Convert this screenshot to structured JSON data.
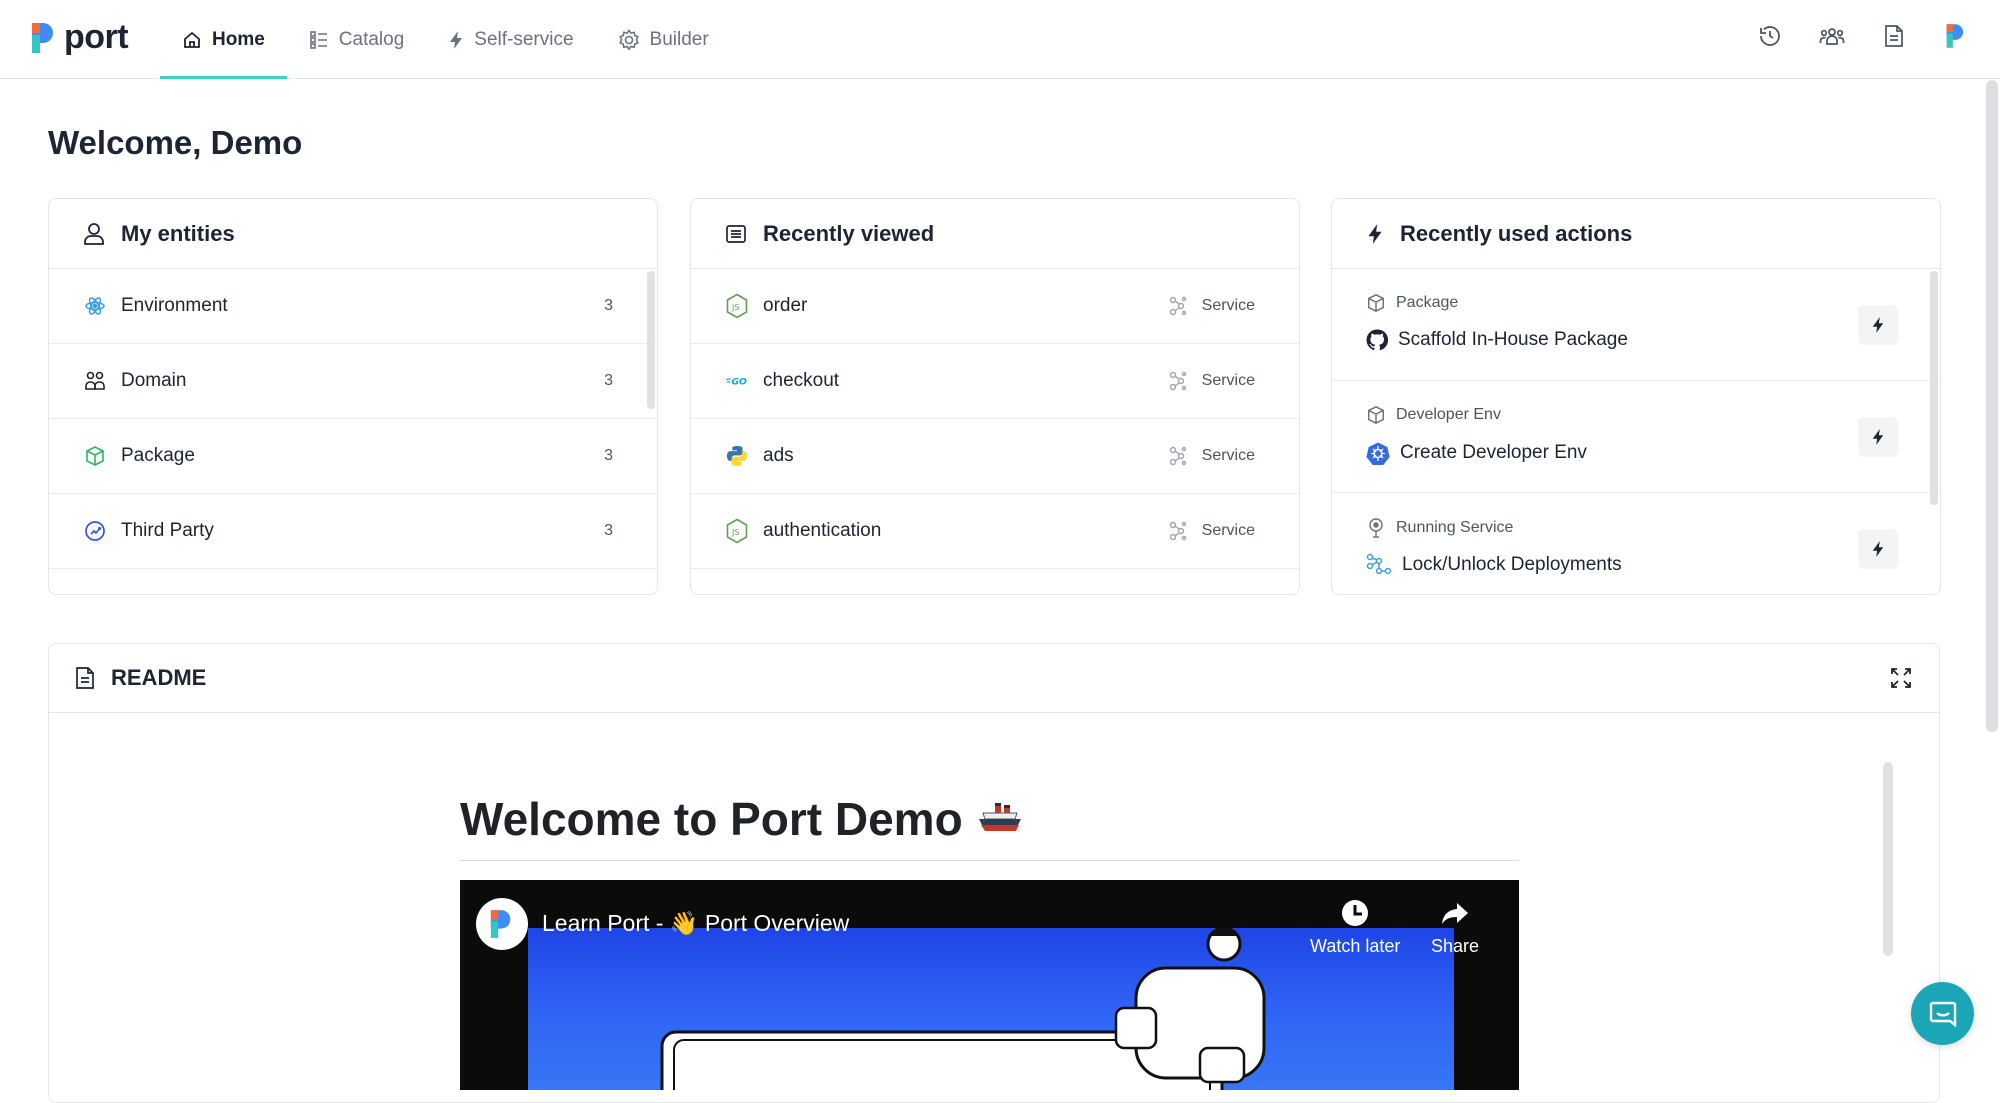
{
  "app": {
    "name": "port"
  },
  "nav": {
    "items": [
      {
        "label": "Home",
        "icon": "home-icon",
        "active": true
      },
      {
        "label": "Catalog",
        "icon": "catalog-icon",
        "active": false
      },
      {
        "label": "Self-service",
        "icon": "lightning-icon",
        "active": false
      },
      {
        "label": "Builder",
        "icon": "gear-icon",
        "active": false
      }
    ],
    "right_icons": [
      "history-icon",
      "users-icon",
      "document-icon",
      "port-logo-icon"
    ]
  },
  "page": {
    "title": "Welcome, Demo"
  },
  "my_entities": {
    "title": "My entities",
    "items": [
      {
        "label": "Environment",
        "count": "3",
        "icon": "environment-icon"
      },
      {
        "label": "Domain",
        "count": "3",
        "icon": "domain-icon"
      },
      {
        "label": "Package",
        "count": "3",
        "icon": "package-icon"
      },
      {
        "label": "Third Party",
        "count": "3",
        "icon": "third-party-icon"
      }
    ]
  },
  "recently_viewed": {
    "title": "Recently viewed",
    "items": [
      {
        "label": "order",
        "type": "Service",
        "icon": "nodejs-icon"
      },
      {
        "label": "checkout",
        "type": "Service",
        "icon": "go-icon"
      },
      {
        "label": "ads",
        "type": "Service",
        "icon": "python-icon"
      },
      {
        "label": "authentication",
        "type": "Service",
        "icon": "nodejs-icon"
      }
    ]
  },
  "recent_actions": {
    "title": "Recently used actions",
    "items": [
      {
        "type": "Package",
        "label": "Scaffold In-House Package",
        "icon": "github-icon"
      },
      {
        "type": "Developer Env",
        "label": "Create Developer Env",
        "icon": "kubernetes-icon"
      },
      {
        "type": "Running Service",
        "label": "Lock/Unlock Deployments",
        "icon": "workflow-icon"
      }
    ]
  },
  "readme": {
    "title": "README",
    "heading": "Welcome to Port Demo",
    "video": {
      "title": "Learn Port - 👋 Port Overview",
      "watch_later": "Watch later",
      "share": "Share"
    }
  },
  "colors": {
    "accent": "#3ecfc6",
    "chat": "#1aa6b7",
    "video_bg": "#2f63f4"
  }
}
